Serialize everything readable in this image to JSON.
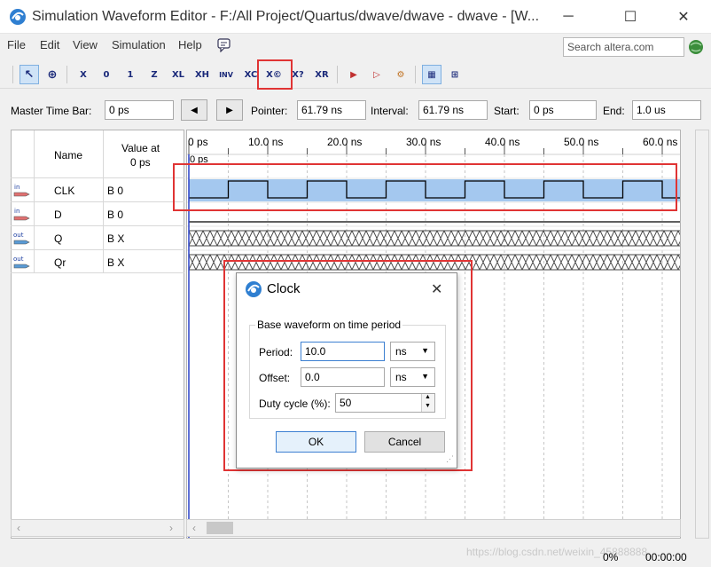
{
  "window": {
    "title": "Simulation Waveform Editor - F:/All Project/Quartus/dwave/dwave - dwave - [W...",
    "minimize_glyph": "─",
    "maximize_glyph": "☐",
    "close_glyph": "✕"
  },
  "menu": {
    "items": [
      {
        "label": "File",
        "name": "menu-file"
      },
      {
        "label": "Edit",
        "name": "menu-edit"
      },
      {
        "label": "View",
        "name": "menu-view"
      },
      {
        "label": "Simulation",
        "name": "menu-simulation"
      },
      {
        "label": "Help",
        "name": "menu-help"
      }
    ],
    "search_placeholder": "Search altera.com"
  },
  "toolbar": {
    "buttons": [
      {
        "icon": "selection-tool-icon",
        "glyph": "↖"
      },
      {
        "icon": "zoom-tool-icon",
        "glyph": "⊕"
      },
      {
        "icon": "force-unknown-icon",
        "glyph": "X"
      },
      {
        "icon": "force-low-icon",
        "glyph": "0"
      },
      {
        "icon": "force-high-icon",
        "glyph": "1"
      },
      {
        "icon": "force-high-impedance-icon",
        "glyph": "Z"
      },
      {
        "icon": "force-weak-low-icon",
        "glyph": "XL"
      },
      {
        "icon": "force-weak-high-icon",
        "glyph": "XH"
      },
      {
        "icon": "invert-icon",
        "glyph": "INV"
      },
      {
        "icon": "count-value-icon",
        "glyph": "XC"
      },
      {
        "icon": "overwrite-clock-icon",
        "glyph": "X©"
      },
      {
        "icon": "arbitrary-value-icon",
        "glyph": "X?"
      },
      {
        "icon": "random-values-icon",
        "glyph": "XR"
      },
      {
        "icon": "run-functional-simulation-icon",
        "glyph": "▶"
      },
      {
        "icon": "run-timing-simulation-icon",
        "glyph": "▷"
      },
      {
        "icon": "generate-netlist-icon",
        "glyph": "⚙"
      },
      {
        "icon": "snap-to-grid-icon",
        "glyph": "▦"
      },
      {
        "icon": "sort-signals-icon",
        "glyph": "⊞"
      }
    ]
  },
  "timebar": {
    "master_label": "Master Time Bar:",
    "master_value": "0 ps",
    "prev_glyph": "◀",
    "next_glyph": "▶",
    "pointer_label": "Pointer:",
    "pointer_value": "61.79 ns",
    "interval_label": "Interval:",
    "interval_value": "61.79 ns",
    "start_label": "Start:",
    "start_value": "0 ps",
    "end_label": "End:",
    "end_value": "1.0 us"
  },
  "signals": {
    "header_name": "Name",
    "header_value_line1": "Value at",
    "header_value_line2": "0 ps",
    "rows": [
      {
        "type": "in",
        "name": "CLK",
        "value": "B 0"
      },
      {
        "type": "in",
        "name": "D",
        "value": "B 0"
      },
      {
        "type": "out",
        "name": "Q",
        "value": "B X"
      },
      {
        "type": "out",
        "name": "Qr",
        "value": "B X"
      }
    ]
  },
  "wave": {
    "ticks": [
      "0 ps",
      "10.0 ns",
      "20.0 ns",
      "30.0 ns",
      "40.0 ns",
      "50.0 ns",
      "60.0 ns"
    ],
    "cursor_label": "0 ps",
    "clock_period_ns": 10,
    "clock_duty": 0.5,
    "end_ns": 62.5,
    "colors": {
      "clk_fill": "#a4c8ef",
      "cursor": "#2a40c8",
      "grid": "#c6c6c6"
    }
  },
  "dialog": {
    "title": "Clock",
    "close_glyph": "✕",
    "group_label": "Base waveform on time period",
    "period_label": "Period:",
    "period_value": "10.0",
    "period_unit": "ns",
    "offset_label": "Offset:",
    "offset_value": "0.0",
    "offset_unit": "ns",
    "duty_label": "Duty cycle (%):",
    "duty_value": "50",
    "ok_label": "OK",
    "cancel_label": "Cancel"
  },
  "status": {
    "progress": "0%",
    "time": "00:00:00",
    "watermark": "https://blog.csdn.net/weixin_45888888"
  }
}
